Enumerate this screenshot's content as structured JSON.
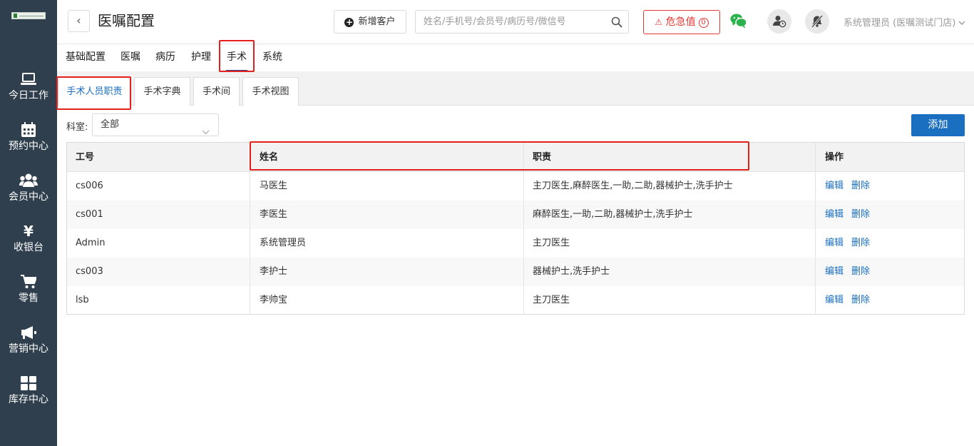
{
  "sidebar": {
    "items": [
      {
        "label": "今日工作",
        "icon": "laptop-icon"
      },
      {
        "label": "预约中心",
        "icon": "calendar-icon"
      },
      {
        "label": "会员中心",
        "icon": "users-icon"
      },
      {
        "label": "收银台",
        "icon": "yen-icon"
      },
      {
        "label": "零售",
        "icon": "cart-icon"
      },
      {
        "label": "营销中心",
        "icon": "megaphone-icon"
      },
      {
        "label": "库存中心",
        "icon": "grid-icon"
      }
    ]
  },
  "header": {
    "back": "‹",
    "title": "医嘱配置",
    "new_customer": "新增客户",
    "search_placeholder": "姓名/手机号/会员号/病历号/微信号",
    "alert_label": "危急值",
    "alert_count": "0",
    "user": "系统管理员 (医嘱测试门店)"
  },
  "main_tabs": [
    {
      "label": "基础配置"
    },
    {
      "label": "医嘱"
    },
    {
      "label": "病历"
    },
    {
      "label": "护理"
    },
    {
      "label": "手术"
    },
    {
      "label": "系统"
    }
  ],
  "active_main_tab": "手术",
  "sub_tabs": [
    {
      "label": "手术人员职责"
    },
    {
      "label": "手术字典"
    },
    {
      "label": "手术间"
    },
    {
      "label": "手术视图"
    }
  ],
  "filter": {
    "label": "科室:",
    "value": "全部"
  },
  "add_button": "添加",
  "table": {
    "headers": [
      "工号",
      "姓名",
      "职责",
      "操作"
    ],
    "rows": [
      {
        "id": "cs006",
        "name": "马医生",
        "duty": "主刀医生,麻醉医生,一助,二助,器械护士,洗手护士"
      },
      {
        "id": "cs001",
        "name": "李医生",
        "duty": "麻醉医生,一助,二助,器械护士,洗手护士"
      },
      {
        "id": "Admin",
        "name": "系统管理员",
        "duty": "主刀医生"
      },
      {
        "id": "cs003",
        "name": "李护士",
        "duty": "器械护士,洗手护士"
      },
      {
        "id": "lsb",
        "name": "李帅宝",
        "duty": "主刀医生"
      }
    ],
    "edit": "编辑",
    "delete": "删除"
  },
  "colors": {
    "sidebar": "#2f3f4d",
    "accent": "#1a6fc1",
    "alert": "#e53935",
    "highlight": "#e3201b"
  }
}
